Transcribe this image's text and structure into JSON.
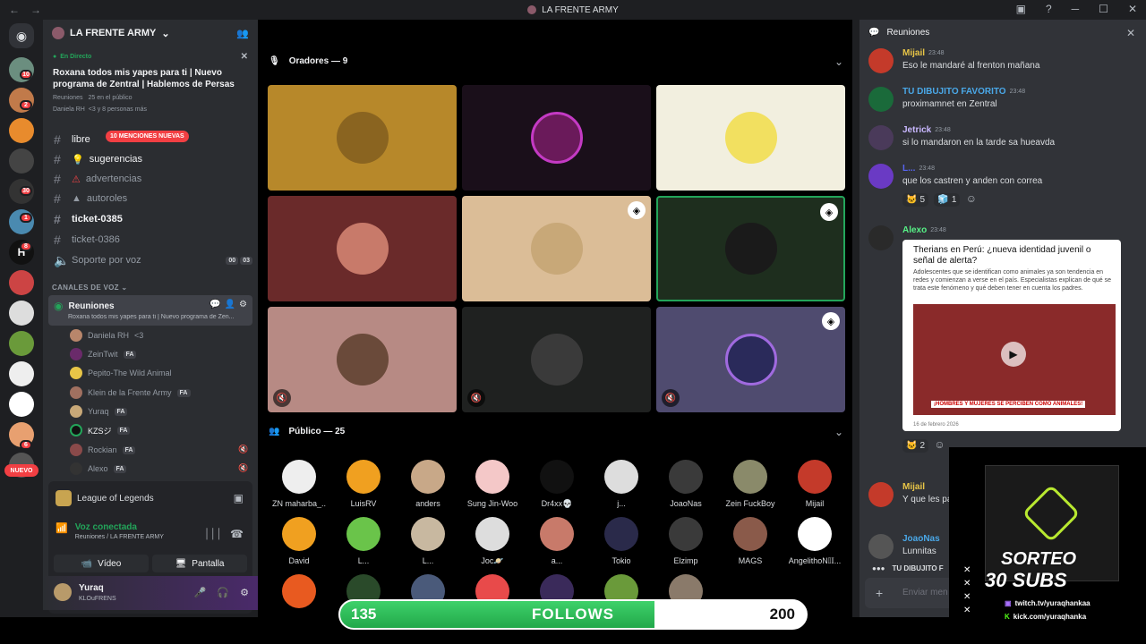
{
  "window": {
    "title": "LA FRENTE ARMY"
  },
  "server": {
    "name": "LA FRENTE ARMY",
    "live": {
      "label": "En Directo",
      "title": "Roxana todos mis yapes para ti | Nuevo programa de Zentral | Hablemos de Persas la...",
      "channel": "Reuniones",
      "listeners": "25 en el público",
      "people": "Daniela RH",
      "people_more": "<3 y 8 personas más"
    },
    "mentions_badge": "10 MENCIONES NUEVAS",
    "channels": [
      {
        "name": "libre",
        "bold": true
      },
      {
        "name": "sugerencias",
        "bold": true
      },
      {
        "name": "advertencias",
        "bold": false
      },
      {
        "name": "autoroles",
        "bold": false
      },
      {
        "name": "ticket-0385",
        "bold": true
      },
      {
        "name": "ticket-0386",
        "bold": false
      },
      {
        "name": "Soporte por voz",
        "bold": false,
        "count_a": "00",
        "count_b": "03"
      }
    ],
    "voice_category": "CANALES DE VOZ",
    "voice_channel": {
      "name": "Reuniones",
      "subtitle": "Roxana todos mis yapes para ti | Nuevo programa de Zen..."
    },
    "voice_users": [
      {
        "name": "Daniela RH",
        "tag": "<3"
      },
      {
        "name": "ZeinTwit",
        "tag": "FA"
      },
      {
        "name": "Pepito-The Wild Animal",
        "tag": ""
      },
      {
        "name": "Klein de la Frente Army",
        "tag": "FA"
      },
      {
        "name": "Yuraq",
        "tag": "FA"
      },
      {
        "name": "KZSジ",
        "tag": "FA"
      },
      {
        "name": "Rockian",
        "tag": "FA"
      },
      {
        "name": "Alexo",
        "tag": "FA"
      }
    ],
    "activity": "League of Legends",
    "voice_connected": "Voz conectada",
    "voice_connected_sub": "Reuniones / LA FRENTE ARMY",
    "video_label": "Vídeo",
    "screen_label": "Pantalla",
    "user": {
      "name": "Yuraq",
      "status": "KLOuFRENS"
    }
  },
  "guild_badges": [
    "10",
    "2",
    "30",
    "1",
    "8",
    "6"
  ],
  "new_label": "NUEVO",
  "stage": {
    "speakers_label": "Oradores — 9",
    "audience_label": "Público — 25",
    "audience": [
      "ZN maharba_...",
      "LuisRV",
      "anders",
      "Sung Jin-Woo",
      "Dr4xx💀",
      "j...",
      "JoaoNas",
      "Zein FuckBoy",
      "Mijail",
      "David",
      "L...",
      "L...",
      "Joc🪐",
      "a...",
      "Tokio",
      "Elzimp",
      "MAGS",
      "AngelithoN𝕀𝕀..."
    ]
  },
  "chat": {
    "title": "Reuniones",
    "messages": [
      {
        "name": "Mijail",
        "time": "23:48",
        "text": "Eso le mandaré al frenton mañana",
        "color": "#e8c547"
      },
      {
        "name": "TU DIBUJITO FAVORITO",
        "time": "23:48",
        "text": "proximamnet en Zentral",
        "color": "#5865f2"
      },
      {
        "name": "Jetrick",
        "time": "23:48",
        "text": "si lo mandaron en la tarde sa hueavda",
        "color": "#c9b8ff"
      },
      {
        "name": "L...",
        "time": "23:48",
        "text": "que los castren y anden con correa",
        "color": "#5865f2"
      },
      {
        "name": "Alexo",
        "time": "23:48",
        "text": "",
        "color": "#57f287"
      }
    ],
    "reactions": [
      "5",
      "1"
    ],
    "reaction2": "2",
    "article": {
      "headline": "Therians en Perú: ¿nueva identidad juvenil o señal de alerta?",
      "body": "Adolescentes que se identifican como animales ya son tendencia en redes y comienzan a verse en el país. Especialistas explican de qué se trata este fenómeno y qué deben tener en cuenta los padres.",
      "caption": "¡HOMBRES Y MUJERES SE PERCIBEN COMO ANIMALES!",
      "date": "16 de febrero 2026"
    },
    "late": [
      {
        "name": "Mijail",
        "text": "Y que les pa"
      },
      {
        "name": "JoaoNas",
        "text": "Lunnitas"
      }
    ],
    "typing": "TU DIBUJITO F",
    "input_placeholder": "Enviar men"
  },
  "follows": {
    "current": "135",
    "label": "FOLLOWS",
    "goal": "200",
    "progress": 0.675
  },
  "promo": {
    "line1": "SORTEO",
    "line2": "30 SUBS",
    "twitch": "twitch.tv/yuraqhankaa",
    "kick": "kick.com/yuraqhanka"
  }
}
